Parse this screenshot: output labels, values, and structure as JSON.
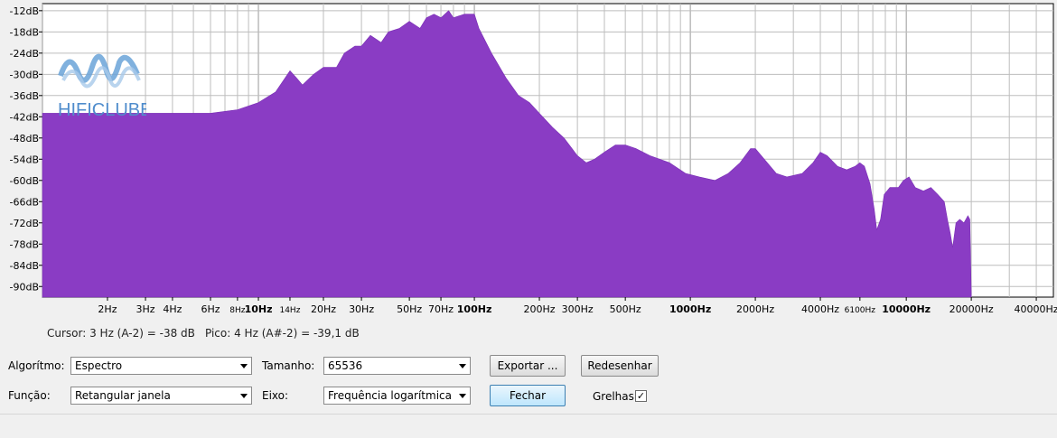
{
  "plot": {
    "y_labels": [
      "-12dB",
      "-18dB",
      "-24dB",
      "-30dB",
      "-36dB",
      "-42dB",
      "-48dB",
      "-54dB",
      "-60dB",
      "-66dB",
      "-72dB",
      "-78dB",
      "-84dB",
      "-90dB"
    ],
    "x_labels": [
      {
        "t": "2Hz",
        "f": 2
      },
      {
        "t": "3Hz",
        "f": 3
      },
      {
        "t": "4Hz",
        "f": 4
      },
      {
        "t": "6Hz",
        "f": 6
      },
      {
        "t": "8Hz",
        "f": 8,
        "small": true
      },
      {
        "t": "10Hz",
        "f": 10,
        "bold": true
      },
      {
        "t": "14Hz",
        "f": 14,
        "small": true
      },
      {
        "t": "20Hz",
        "f": 20
      },
      {
        "t": "30Hz",
        "f": 30
      },
      {
        "t": "50Hz",
        "f": 50
      },
      {
        "t": "70Hz",
        "f": 70
      },
      {
        "t": "100Hz",
        "f": 100,
        "bold": true
      },
      {
        "t": "200Hz",
        "f": 200
      },
      {
        "t": "300Hz",
        "f": 300
      },
      {
        "t": "500Hz",
        "f": 500
      },
      {
        "t": "1000Hz",
        "f": 1000,
        "bold": true
      },
      {
        "t": "2000Hz",
        "f": 2000
      },
      {
        "t": "4000Hz",
        "f": 4000
      },
      {
        "t": "6100Hz",
        "f": 6100,
        "small": true
      },
      {
        "t": "10000Hz",
        "f": 10000,
        "bold": true
      },
      {
        "t": "20000Hz",
        "f": 20000
      },
      {
        "t": "40000Hz",
        "f": 40000
      }
    ],
    "fill_color": "#8a3cc4",
    "grid_color": "#bdbdbd",
    "spectrum": [
      [
        1,
        -41
      ],
      [
        6,
        -41
      ],
      [
        8,
        -40
      ],
      [
        10,
        -38
      ],
      [
        12,
        -35
      ],
      [
        14,
        -29
      ],
      [
        15,
        -31
      ],
      [
        16,
        -33
      ],
      [
        18,
        -30
      ],
      [
        20,
        -28
      ],
      [
        23,
        -28
      ],
      [
        25,
        -24
      ],
      [
        28,
        -22
      ],
      [
        30,
        -22
      ],
      [
        33,
        -19
      ],
      [
        37,
        -21
      ],
      [
        40,
        -18
      ],
      [
        45,
        -17
      ],
      [
        50,
        -15
      ],
      [
        56,
        -17
      ],
      [
        60,
        -14
      ],
      [
        65,
        -13
      ],
      [
        70,
        -14
      ],
      [
        76,
        -12
      ],
      [
        80,
        -14
      ],
      [
        90,
        -13
      ],
      [
        100,
        -13
      ],
      [
        105,
        -17
      ],
      [
        120,
        -24
      ],
      [
        140,
        -31
      ],
      [
        160,
        -36
      ],
      [
        180,
        -38
      ],
      [
        200,
        -41
      ],
      [
        230,
        -45
      ],
      [
        260,
        -48
      ],
      [
        300,
        -53
      ],
      [
        330,
        -55
      ],
      [
        360,
        -54
      ],
      [
        400,
        -52
      ],
      [
        450,
        -50
      ],
      [
        500,
        -50
      ],
      [
        560,
        -51
      ],
      [
        650,
        -53
      ],
      [
        800,
        -55
      ],
      [
        950,
        -58
      ],
      [
        1100,
        -59
      ],
      [
        1300,
        -60
      ],
      [
        1500,
        -58
      ],
      [
        1700,
        -55
      ],
      [
        1900,
        -51
      ],
      [
        2000,
        -51
      ],
      [
        2200,
        -54
      ],
      [
        2500,
        -58
      ],
      [
        2800,
        -59
      ],
      [
        3300,
        -58
      ],
      [
        3700,
        -55
      ],
      [
        4000,
        -52
      ],
      [
        4300,
        -53
      ],
      [
        4800,
        -56
      ],
      [
        5300,
        -57
      ],
      [
        5800,
        -56
      ],
      [
        6100,
        -55
      ],
      [
        6400,
        -56
      ],
      [
        6800,
        -61
      ],
      [
        7100,
        -68
      ],
      [
        7300,
        -74
      ],
      [
        7600,
        -71
      ],
      [
        7900,
        -64
      ],
      [
        8400,
        -62
      ],
      [
        9200,
        -62
      ],
      [
        9700,
        -60
      ],
      [
        10300,
        -59
      ],
      [
        11000,
        -62
      ],
      [
        12000,
        -63
      ],
      [
        13000,
        -62
      ],
      [
        14000,
        -64
      ],
      [
        15000,
        -66
      ],
      [
        15500,
        -71
      ],
      [
        16000,
        -75
      ],
      [
        16400,
        -79
      ],
      [
        17000,
        -72
      ],
      [
        17700,
        -71
      ],
      [
        18500,
        -72
      ],
      [
        19300,
        -70
      ],
      [
        19700,
        -71
      ],
      [
        20000,
        -92
      ]
    ]
  },
  "logo": {
    "text": "HIFICLUBE"
  },
  "info": {
    "cursor": "Cursor: 3 Hz (A-2) = -38 dB",
    "peak": "Pico: 4 Hz (A#-2) = -39,1 dB"
  },
  "controls": {
    "algorithm_label": "Algorítmo:",
    "algorithm_value": "Espectro",
    "function_label": "Função:",
    "function_value": "Retangular janela",
    "size_label": "Tamanho:",
    "size_value": "65536",
    "axis_label": "Eixo:",
    "axis_value": "Frequência logarítmica",
    "export_label": "Exportar ...",
    "redraw_label": "Redesenhar",
    "close_label": "Fechar",
    "grids_label": "Grelhas",
    "grids_checked": "✓"
  }
}
